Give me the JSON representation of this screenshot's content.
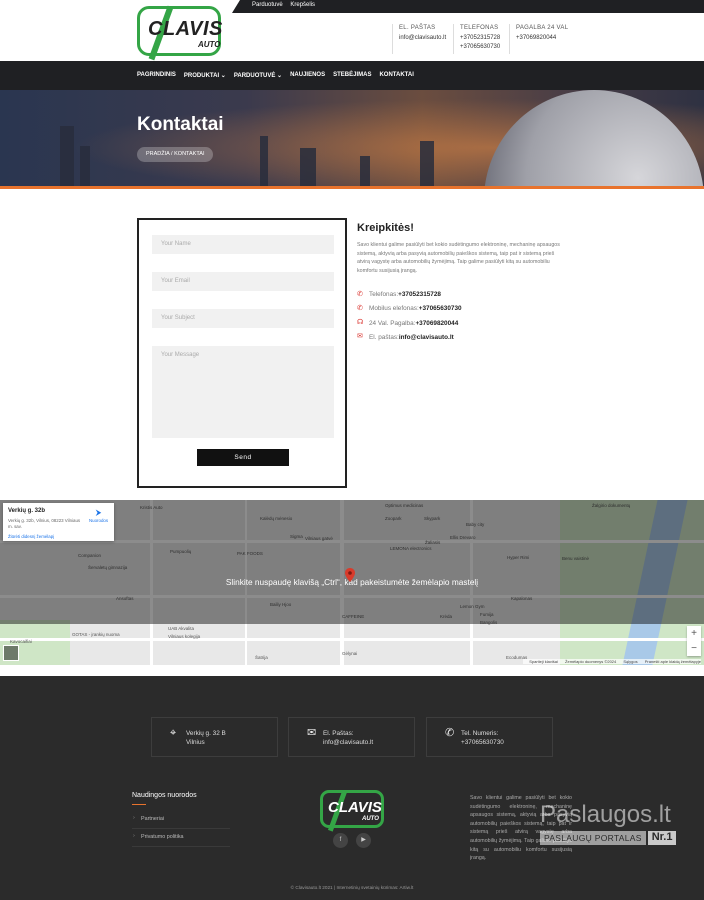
{
  "colors": {
    "accent_orange": "#e8732d",
    "brand_green": "#34a546",
    "dark": "#1f2023"
  },
  "topbar": {
    "links": [
      "Parduotuvė",
      "Krepšelis"
    ]
  },
  "logo": {
    "brand": "CLAVIS",
    "sub": "AUTO"
  },
  "header_contacts": [
    {
      "heading": "EL. PAŠTAS",
      "lines": [
        "info@clavisauto.lt"
      ]
    },
    {
      "heading": "TELEFONAS",
      "lines": [
        "+37052315728",
        "+37065630730"
      ]
    },
    {
      "heading": "PAGALBA 24 VAL",
      "lines": [
        "+37069820044"
      ]
    }
  ],
  "nav": {
    "items": [
      "PAGRINDINIS",
      "PRODUKTAI ⌄",
      "PARDUOTUVĖ ⌄",
      "NAUJIENOS",
      "STEBĖJIMAS",
      "KONTAKTAI"
    ]
  },
  "hero": {
    "title": "Kontaktai",
    "breadcrumb": "PRADŽIA / KONTAKTAI"
  },
  "form": {
    "name_placeholder": "Your Name",
    "email_placeholder": "Your Email",
    "subject_placeholder": "Your Subject",
    "message_placeholder": "Your Message",
    "send_label": "Send"
  },
  "info": {
    "title": "Kreipkitės!",
    "text": "Savo klientui galime pasiūlyti bet kokio sudėtingumo elektroninę, mechaninę apsaugos sistemą, aktyvią arba pasyvią automobilių paieškos sistemą, taip pat ir sistemą prieš atvirą vagystę arba automobilių žymėjimą. Taip galime pasiūlyti kitą su automobiliu komfortu susijusią įrangą.",
    "lines": [
      {
        "icon": "phone-icon",
        "glyph": "✆",
        "label": "Telefonas: ",
        "value": "+37052315728"
      },
      {
        "icon": "mobile-icon",
        "glyph": "✆",
        "label": "Mobilus elefonas: ",
        "value": "+37065630730"
      },
      {
        "icon": "headset-icon",
        "glyph": "☊",
        "label": "24 Val. Pagalba: ",
        "value": "+37069820044"
      },
      {
        "icon": "mail-icon",
        "glyph": "✉",
        "label": "El. paštas: ",
        "value": "info@clavisauto.lt"
      }
    ]
  },
  "map": {
    "card_title": "Verkių g. 32b",
    "card_address": "Verkių g. 32b, Vilnius, 08223 Vilniaus m. sav.",
    "card_link": "Žiūrėti didesnį žemėlapį",
    "directions": "Nuorodos",
    "overlay_text": "Slinkite nuspaudę klavišą „Ctrl“, kad pakeistumėte žemėlapio mastelį",
    "attribution": [
      "Spartieji klavišai",
      "Žemėlapio duomenys ©2024",
      "Sąlygos",
      "Pranešti apie klaidą žemėlapyje"
    ],
    "labels": [
      "Kristis Auto",
      "Optimus medicinas",
      "Žalgirio dokumentų",
      "Zoopark",
      "Skypark",
      "Baby city",
      "Kalėdų mėnesio",
      "Žaliasis",
      "Vilniaus gatvė",
      "PAK FOODS",
      "Sigma",
      "LEMONA electronics",
      "Ellis Drevaro",
      "Hyper Rimi",
      "Benu vaistinė",
      "Companion",
      "Šervaletų gimnazija",
      "Pumpuolių",
      "Ansoftas",
      "Bailiy Hjoo",
      "CAFFEINE",
      "Lemon Gym",
      "Kapalonas",
      "Krėda",
      "Fumija",
      "Bangolis",
      "GOTAS - įrankių nuoma",
      "UAB Akvalita",
      "Vilniaus kolegija",
      "Kavocaifiai",
      "Šatrija",
      "Gėlynai",
      "Ecodumas"
    ],
    "zoom_in": "+",
    "zoom_out": "−"
  },
  "footer": {
    "address": [
      "Verkių g. 32 B",
      "Vilnius"
    ],
    "email": [
      "El. Paštas:",
      "info@clavisauto.lt"
    ],
    "phone": [
      "Tel. Numeris:",
      "+37065630730"
    ],
    "links_title": "Naudingos nuorodos",
    "links": [
      "Partneriai",
      "Privatumo politika"
    ],
    "social": [
      "f",
      "▶"
    ],
    "description": "Savo klientui galime pasiūlyti bet kokio sudėtingumo elektroninę, mechaninę apsaugos sistemą, aktyvią arba pasyvią automobilių paieškos sistemą, taip pat ir sistemą prieš atvirą vagystę arba automobilių žymėjimą. Taip galime pasiūlyti kitą su automobiliu komfortu susijusią įrangą.",
    "badge_big": "Paslaugos.lt",
    "badge_small": "PASLAUGŲ PORTALAS",
    "badge_nr": "Nr.1",
    "copyright": "© Clavisauto.lt 2021 | Internetinių svetainių kūrimas: Artiw.lt"
  }
}
